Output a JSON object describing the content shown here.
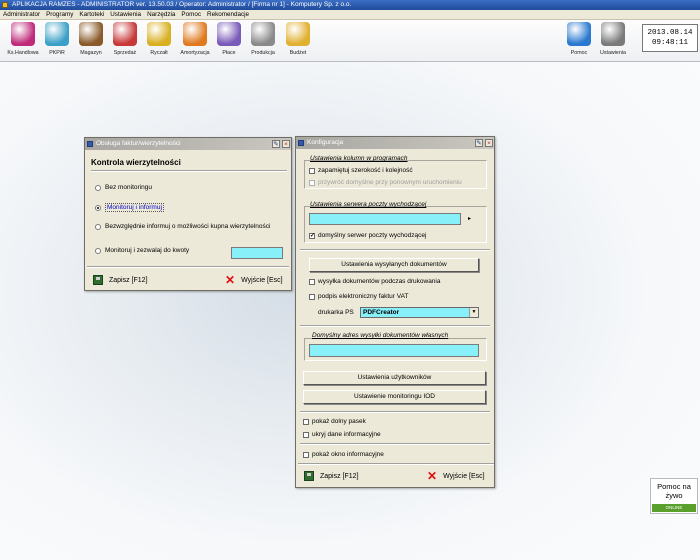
{
  "app": {
    "title": "APLIKACJA RAMZES - ADMINISTRATOR ver. 13.50.03 /  Operator: Administrator /  [Firma nr 1] - Komputery Sp. z o.o."
  },
  "menu": [
    "Administrator",
    "Programy",
    "Kartoteki",
    "Ustawienia",
    "Narzędzia",
    "Pomoc",
    "Rekomendacje"
  ],
  "toolbar": [
    {
      "label": "Ks.Handlowa",
      "icon": "book-icon",
      "color": "#c02a7a"
    },
    {
      "label": "PKPiR",
      "icon": "ledger-icon",
      "color": "#3aa0c8"
    },
    {
      "label": "Magazyn",
      "icon": "warehouse-box-icon",
      "color": "#8a5a2a"
    },
    {
      "label": "Sprzedaż",
      "icon": "invoice-icon",
      "color": "#c83838"
    },
    {
      "label": "Ryczałt",
      "icon": "coins-stack-icon",
      "color": "#d8b020"
    },
    {
      "label": "Amortyzacja",
      "icon": "assets-icon",
      "color": "#e07a20"
    },
    {
      "label": "Płace",
      "icon": "people-icon",
      "color": "#7a5ab8"
    },
    {
      "label": "Produkcja",
      "icon": "gear-icon",
      "color": "#8a8a8a"
    },
    {
      "label": "Budżet",
      "icon": "piggy-coin-icon",
      "color": "#e0b030"
    },
    {
      "label": "Pomoc",
      "icon": "help-icon",
      "color": "#2a78d0"
    },
    {
      "label": "Ustawienia",
      "icon": "tools-icon",
      "color": "#7a7a7a"
    }
  ],
  "clock": {
    "date": "2013.08.14",
    "time": "09:48:11"
  },
  "dialog1": {
    "title": "Obsługa faktur/wierzytelności",
    "header": "Kontrola wierzytelności",
    "options": [
      "Bez monitoringu",
      "Monitoruj i informuj",
      "Bezwzględnie informuj o możliwości kupna wierzytelności",
      "Monitoruj i zezwalaj do kwoty"
    ],
    "selected": 1,
    "amount": "",
    "save": "Zapisz  [F12]",
    "exit": "Wyjście  [Esc]"
  },
  "dialog2": {
    "title": "Konfiguracja",
    "group1_label": "Ustawienia kolumn w programach",
    "chk_remember": "zapamiętuj szerokość i kolejność",
    "chk_restore": "przywróć domyślne przy ponownym uruchomieniu",
    "group2_label": "Ustawienia serwera poczty wychodzącej",
    "smtp_value": "",
    "chk_default_server": "domyślny serwer poczty wychodzącej",
    "btn_sent_docs": "Ustawienia wysyłanych dokumentów",
    "chk_send_print": "wysyłka dokumentów podczas drukowania",
    "chk_sign": "podpis elektroniczny faktur VAT",
    "printer_label": "drukarka PS",
    "printer_value": "PDFCreator",
    "group3_label": "Domyślny adres wysyłki dokumentów własnych",
    "address_value": "",
    "btn_users": "Ustawienia użytkowników",
    "btn_monitoring": "Ustawienie monitoringu IOD",
    "chk_bottom_bar": "pokaż dolny pasek",
    "chk_hide_info": "ukryj dane informacyjne",
    "chk_show_info": "pokaż okno informacyjne",
    "save": "Zapisz  [F12]",
    "exit": "Wyjście  [Esc]"
  },
  "help_widget": {
    "line1": "Pomoc na",
    "line2": "żywo",
    "status": "ONLINE"
  }
}
